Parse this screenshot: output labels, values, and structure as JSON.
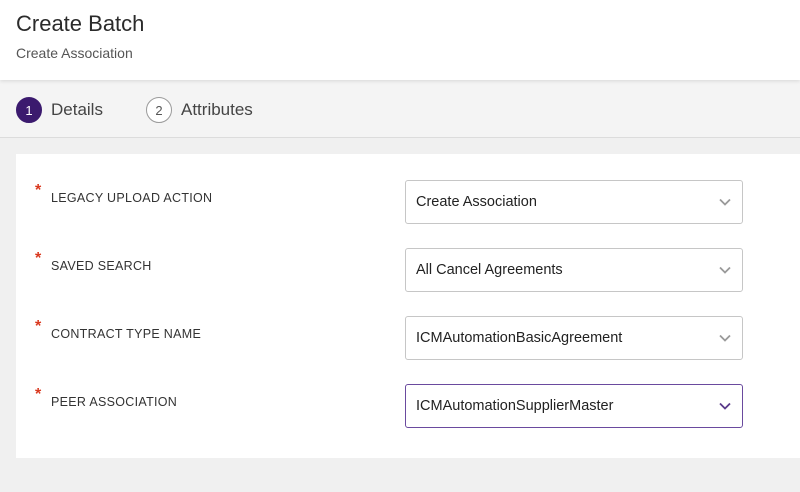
{
  "header": {
    "title": "Create Batch",
    "subtitle": "Create Association"
  },
  "steps": [
    {
      "number": "1",
      "label": "Details",
      "active": true
    },
    {
      "number": "2",
      "label": "Attributes",
      "active": false
    }
  ],
  "form": {
    "required_marker": "*",
    "fields": [
      {
        "label": "LEGACY UPLOAD ACTION",
        "value": "Create Association"
      },
      {
        "label": "SAVED SEARCH",
        "value": "All Cancel Agreements"
      },
      {
        "label": "CONTRACT TYPE NAME",
        "value": "ICMAutomationBasicAgreement"
      },
      {
        "label": "PEER ASSOCIATION",
        "value": "ICMAutomationSupplierMaster",
        "focused": true
      }
    ]
  },
  "colors": {
    "accent": "#3b1a6e",
    "required": "#d9381e",
    "focus_border": "#6a4a9e"
  },
  "icons": {
    "dropdown": "chevron-down-icon"
  }
}
